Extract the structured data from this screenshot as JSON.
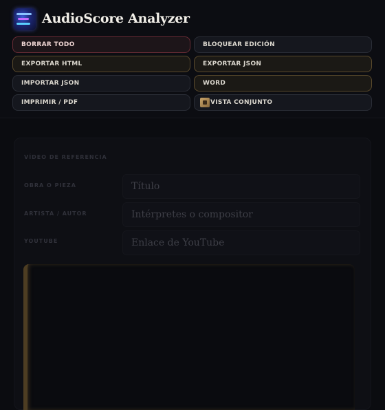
{
  "app": {
    "title": "AudioScore Analyzer"
  },
  "toolbar": {
    "clear_all": "BORRAR TODO",
    "lock_edit": "BLOQUEAR EDICIÓN",
    "export_html": "EXPORTAR HTML",
    "export_json": "EXPORTAR JSON",
    "import_json": "IMPORTAR JSON",
    "word": "WORD",
    "print_pdf": "IMPRIMIR / PDF",
    "overview": "VISTA CONJUNTO"
  },
  "reference": {
    "section_label": "VÍDEO DE REFERENCIA",
    "fields": {
      "work": {
        "label": "OBRA O PIEZA",
        "placeholder": "Título"
      },
      "artist": {
        "label": "ARTISTA / AUTOR",
        "placeholder": "Intérpretes o compositor"
      },
      "youtube": {
        "label": "YOUTUBE",
        "placeholder": "Enlace de YouTube"
      }
    }
  },
  "colors": {
    "background": "#0b0c10",
    "danger_border": "#6a2c35",
    "gold_border": "#5a4a2c",
    "accent_video": "#4d3d22"
  }
}
